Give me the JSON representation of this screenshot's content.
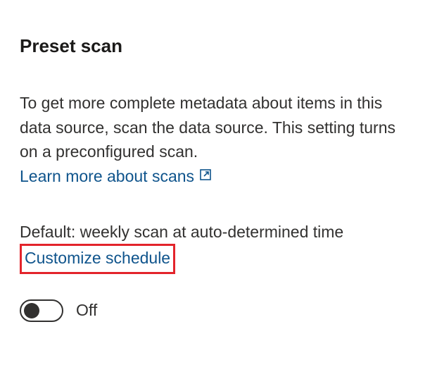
{
  "section": {
    "title": "Preset scan",
    "description": "To get more complete metadata about items in this data source, scan the data source. This setting turns on a preconfigured scan.",
    "learn_more_label": "Learn more about scans",
    "default_prefix": "Default: weekly scan at auto-determined time",
    "customize_label": "Customize schedule",
    "toggle_state_label": "Off"
  }
}
